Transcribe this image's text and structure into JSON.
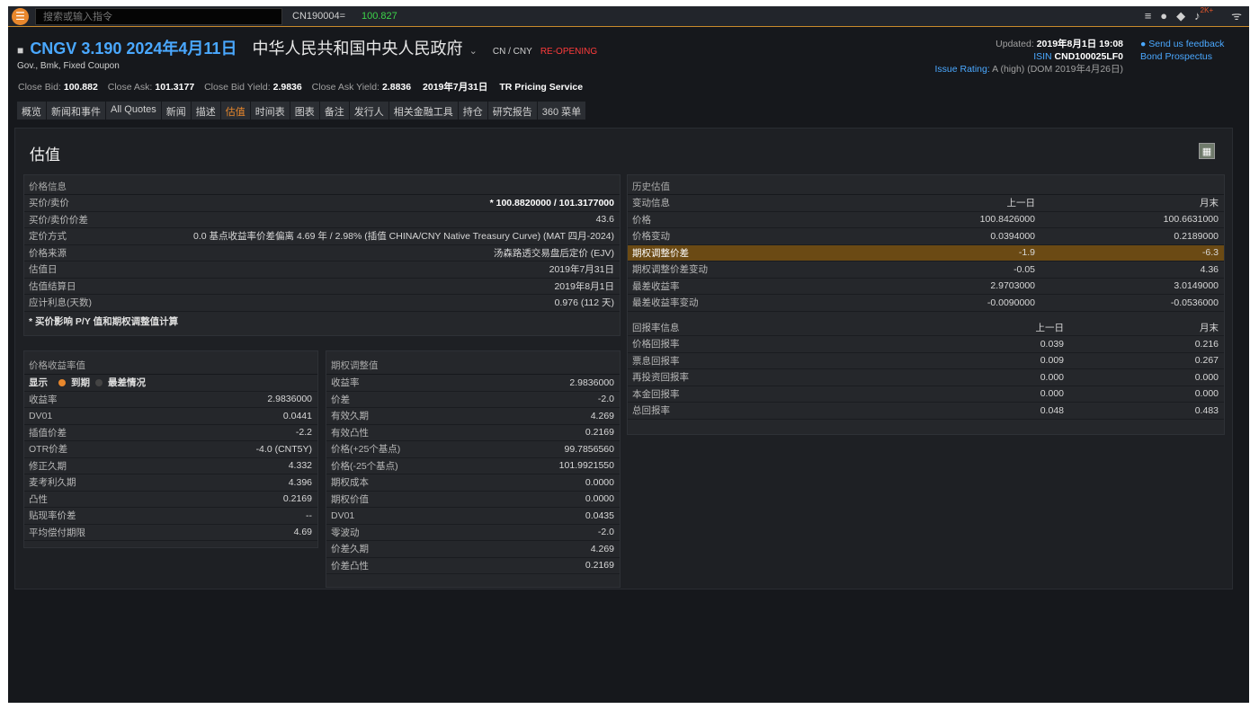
{
  "topbar": {
    "menu_glyph": "☰",
    "search_placeholder": "搜索或输入指令",
    "ticker_symbol": "CN190004=",
    "ticker_value": "100.827",
    "notification_badge": "2K+"
  },
  "header": {
    "ric": "CNGV 3.190 2024年4月11日",
    "issuer": "中华人民共和国中央人民政府",
    "chevron": "⌄",
    "currency": "CN / CNY",
    "status": "RE-OPENING",
    "subtitle": "Gov., Bmk, Fixed Coupon",
    "close_bid_label": "Close Bid:",
    "close_bid": "100.882",
    "close_ask_label": "Close Ask:",
    "close_ask": "101.3177",
    "close_bid_yield_label": "Close Bid Yield:",
    "close_bid_yield": "2.9836",
    "close_ask_yield_label": "Close Ask Yield:",
    "close_ask_yield": "2.8836",
    "price_date": "2019年7月31日",
    "pricing_service": "TR Pricing Service",
    "updated_label": "Updated:",
    "updated": "2019年8月1日 19:08",
    "isin_label": "ISIN",
    "isin": "CND100025LF0",
    "rating_label": "Issue Rating:",
    "rating": "A (high) (DOM 2019年4月26日)",
    "feedback_link": "Send us feedback",
    "prospectus_link": "Bond Prospectus"
  },
  "tabs": [
    {
      "label": "概览"
    },
    {
      "label": "新闻和事件"
    },
    {
      "label": "All Quotes"
    },
    {
      "label": "新闻"
    },
    {
      "label": "描述"
    },
    {
      "label": "估值"
    },
    {
      "label": "时间表"
    },
    {
      "label": "图表"
    },
    {
      "label": "备注"
    },
    {
      "label": "发行人"
    },
    {
      "label": "相关金融工具"
    },
    {
      "label": "持仓"
    },
    {
      "label": "研究报告"
    },
    {
      "label": "360 菜单"
    }
  ],
  "active_tab": "估值",
  "page_title": "估值",
  "price_info": {
    "title": "价格信息",
    "rows": [
      {
        "k": "买价/卖价",
        "v": "* 100.8820000 / 101.3177000"
      },
      {
        "k": "买价/卖价价差",
        "v": "43.6"
      },
      {
        "k": "定价方式",
        "v": "0.0 基点收益率价差偏离 4.69 年 / 2.98% (插值 CHINA/CNY Native Treasury Curve) (MAT 四月-2024)"
      },
      {
        "k": "价格来源",
        "v": "汤森路透交易盘后定价 (EJV)"
      },
      {
        "k": "估值日",
        "v": "2019年7月31日"
      },
      {
        "k": "估值结算日",
        "v": "2019年8月1日"
      },
      {
        "k": "应计利息(天数)",
        "v": "0.976 (112 天)"
      }
    ],
    "note": "* 买价影响 P/Y 值和期权调整值计算"
  },
  "yield_values": {
    "title": "价格收益率值",
    "display_label": "显示",
    "option_maturity": "到期",
    "option_worst": "最差情况",
    "rows": [
      {
        "k": "收益率",
        "v": "2.9836000"
      },
      {
        "k": "DV01",
        "v": "0.0441"
      },
      {
        "k": "插值价差",
        "v": "-2.2"
      },
      {
        "k": "OTR价差",
        "v": "-4.0 (CNT5Y)"
      },
      {
        "k": "修正久期",
        "v": "4.332"
      },
      {
        "k": "麦考利久期",
        "v": "4.396"
      },
      {
        "k": "凸性",
        "v": "0.2169"
      },
      {
        "k": "贴现率价差",
        "v": "--"
      },
      {
        "k": "平均偿付期限",
        "v": "4.69"
      }
    ]
  },
  "option_adjusted": {
    "title": "期权调整值",
    "rows": [
      {
        "k": "收益率",
        "v": "2.9836000"
      },
      {
        "k": "价差",
        "v": "-2.0"
      },
      {
        "k": "有效久期",
        "v": "4.269"
      },
      {
        "k": "有效凸性",
        "v": "0.2169"
      },
      {
        "k": "价格(+25个基点)",
        "v": "99.7856560"
      },
      {
        "k": "价格(-25个基点)",
        "v": "101.9921550"
      },
      {
        "k": "期权成本",
        "v": "0.0000"
      },
      {
        "k": "期权价值",
        "v": "0.0000"
      },
      {
        "k": "DV01",
        "v": "0.0435"
      },
      {
        "k": "零波动",
        "v": "-2.0"
      },
      {
        "k": "价差久期",
        "v": "4.269"
      },
      {
        "k": "价差凸性",
        "v": "0.2169"
      }
    ]
  },
  "history": {
    "title": "历史估值",
    "change_header": {
      "k": "变动信息",
      "c1": "上一日",
      "c2": "月末"
    },
    "change_rows": [
      {
        "k": "价格",
        "c1": "100.8426000",
        "c2": "100.6631000"
      },
      {
        "k": "价格变动",
        "c1": "0.0394000",
        "c2": "0.2189000"
      },
      {
        "k": "期权调整价差",
        "c1": "-1.9",
        "c2": "-6.3"
      },
      {
        "k": "期权调整价差变动",
        "c1": "-0.05",
        "c2": "4.36"
      },
      {
        "k": "最差收益率",
        "c1": "2.9703000",
        "c2": "3.0149000"
      },
      {
        "k": "最差收益率变动",
        "c1": "-0.0090000",
        "c2": "-0.0536000"
      }
    ],
    "return_header": {
      "k": "回报率信息",
      "c1": "上一日",
      "c2": "月末"
    },
    "return_rows": [
      {
        "k": "价格回报率",
        "c1": "0.039",
        "c2": "0.216"
      },
      {
        "k": "票息回报率",
        "c1": "0.009",
        "c2": "0.267"
      },
      {
        "k": "再投资回报率",
        "c1": "0.000",
        "c2": "0.000"
      },
      {
        "k": "本金回报率",
        "c1": "0.000",
        "c2": "0.000"
      },
      {
        "k": "总回报率",
        "c1": "0.048",
        "c2": "0.483"
      }
    ]
  },
  "colors": {
    "accent": "#e8872c",
    "link": "#4aa8ff",
    "highlight_row": "#6b4a14",
    "reopen": "#ff3b3b",
    "ticker_up": "#3cd54a"
  }
}
